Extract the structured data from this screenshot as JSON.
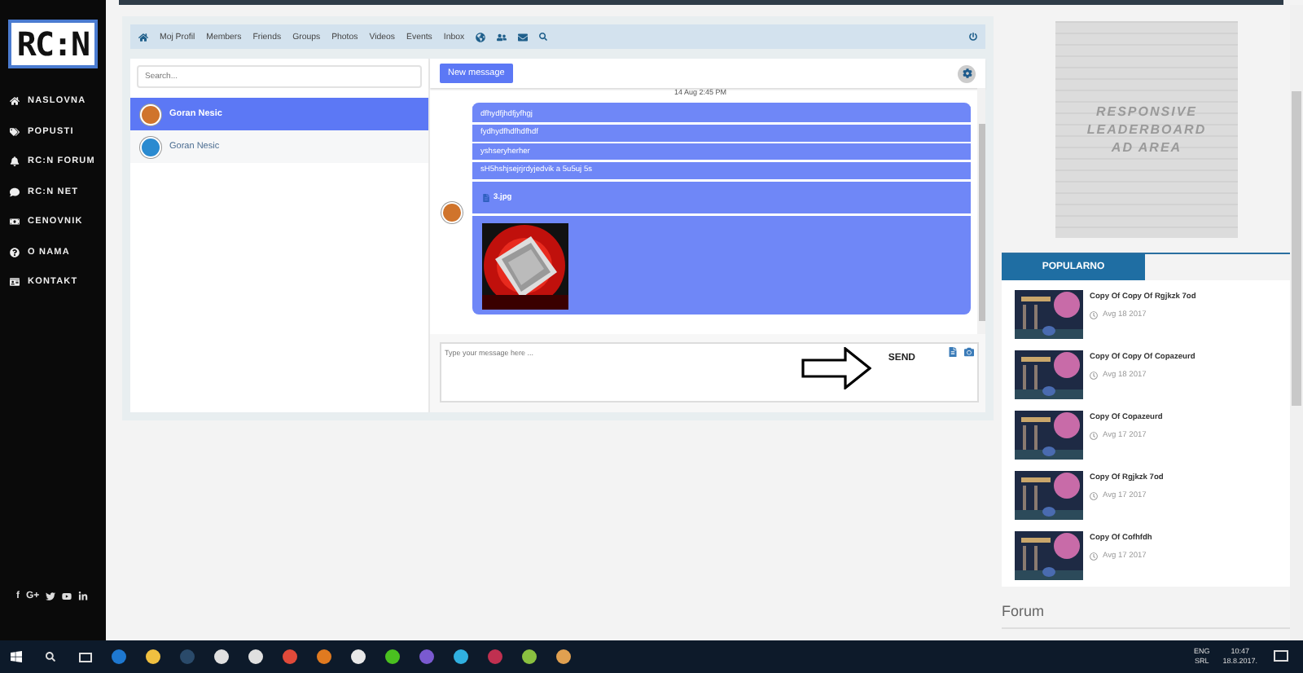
{
  "sidebar": {
    "logo": "RC:N",
    "items": [
      {
        "label": "NASLOVNA"
      },
      {
        "label": "POPUSTI"
      },
      {
        "label": "RC:N FORUM"
      },
      {
        "label": "RC:N NET"
      },
      {
        "label": "CENOVNIK"
      },
      {
        "label": "O NAMA"
      },
      {
        "label": "KONTAKT"
      }
    ],
    "social": [
      "f",
      "G+"
    ]
  },
  "navbar": {
    "links": [
      "Moj Profil",
      "Members",
      "Friends",
      "Groups",
      "Photos",
      "Videos",
      "Events",
      "Inbox"
    ]
  },
  "conversations": {
    "search": {
      "placeholder": "Search..."
    },
    "items": [
      {
        "name": "Goran Nesic",
        "selected": true
      },
      {
        "name": "Goran Nesic",
        "selected": false
      }
    ]
  },
  "chat": {
    "new_button": "New message",
    "date": "14 Aug 2:45 PM",
    "messages": [
      "dfhydfjhdfjyfhgj",
      "fydhydfhdfhdfhdf",
      "yshseryherher",
      "sH5hshjsejrjrdyjedvik a 5u5uj 5s"
    ],
    "attachment": {
      "file": "3.jpg",
      "kind": "picture"
    },
    "input": {
      "placeholder": "Type your message here ...",
      "send": "SEND"
    }
  },
  "ad": {
    "lines": [
      "RESPONSIVE",
      "LEADERBOARD",
      "AD AREA"
    ]
  },
  "popular": {
    "tab": "POPULARNO",
    "items": [
      {
        "title": "Copy Of Copy Of Rgjkzk 7od",
        "date": "Avg 18 2017"
      },
      {
        "title": "Copy Of Copy Of Copazeurd",
        "date": "Avg 18 2017"
      },
      {
        "title": "Copy Of Copazeurd",
        "date": "Avg 17 2017"
      },
      {
        "title": "Copy Of Rgjkzk 7od",
        "date": "Avg 17 2017"
      },
      {
        "title": "Copy Of Cofhfdh",
        "date": "Avg 17 2017"
      }
    ]
  },
  "forum": {
    "title": "Forum"
  },
  "taskbar": {
    "language": "ENG",
    "layout": "SRL",
    "time": "10:47",
    "date": "18.8.2017."
  }
}
